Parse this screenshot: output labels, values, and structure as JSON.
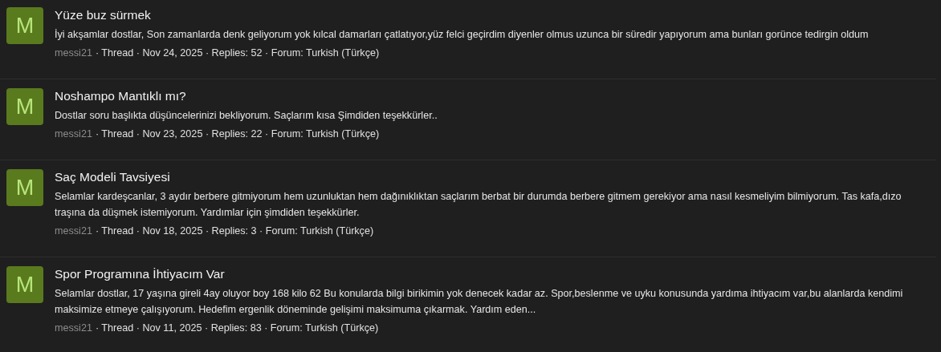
{
  "threads": [
    {
      "avatar": "M",
      "title": "Yüze buz sürmek",
      "snippet": "İyi akşamlar dostlar, Son zamanlarda denk geliyorum yok kılcal damarları çatlatıyor,yüz felci geçirdim diyenler olmus uzunca bir süredir yapıyorum ama bunları gorünce tedirgin oldum",
      "author": "messi21",
      "details": "· Thread · Nov 24, 2025 · Replies: 52 · Forum: Turkish (Türkçe)"
    },
    {
      "avatar": "M",
      "title": "Noshampo Mantıklı mı?",
      "snippet": "Dostlar soru başlıkta düşüncelerinizi bekliyorum. Saçlarım kısa Şimdiden teşekkürler..",
      "author": "messi21",
      "details": "· Thread · Nov 23, 2025 · Replies: 22 · Forum: Turkish (Türkçe)"
    },
    {
      "avatar": "M",
      "title": "Saç Modeli Tavsiyesi",
      "snippet": "Selamlar kardeşcanlar, 3 aydır berbere gitmiyorum hem uzunluktan hem dağınıklıktan saçlarım berbat bir durumda berbere gitmem gerekiyor ama nasıl kesmeliyim bilmiyorum. Tas kafa,dızo traşına da düşmek istemiyorum. Yardımlar için şimdiden teşekkürler.",
      "author": "messi21",
      "details": "· Thread · Nov 18, 2025 · Replies: 3 · Forum: Turkish (Türkçe)"
    },
    {
      "avatar": "M",
      "title": "Spor Programına İhtiyacım Var",
      "snippet": "Selamlar dostlar, 17 yaşına gireli 4ay oluyor boy 168 kilo 62 Bu konularda bilgi birikimin yok denecek kadar az. Spor,beslenme ve uyku konusunda yardıma ihtiyacım var,bu alanlarda kendimi maksimize etmeye çalışıyorum. Hedefim ergenlik döneminde gelişimi maksimuma çıkarmak. Yardım eden...",
      "author": "messi21",
      "details": "· Thread · Nov 11, 2025 · Replies: 83 · Forum: Turkish (Türkçe)"
    }
  ]
}
